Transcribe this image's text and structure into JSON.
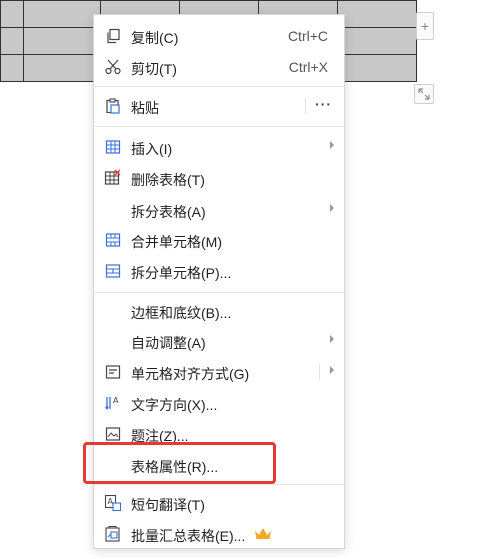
{
  "menu": {
    "items": [
      {
        "label": "复制(C)",
        "shortcut": "Ctrl+C",
        "icon": "copy-icon"
      },
      {
        "label": "剪切(T)",
        "shortcut": "Ctrl+X",
        "icon": "scissors-icon"
      },
      {
        "label": "粘贴",
        "more": "···",
        "icon": "paste-icon"
      },
      {
        "label": "插入(I)",
        "icon": "table-insert-icon",
        "submenu": true
      },
      {
        "label": "删除表格(T)",
        "icon": "table-delete-icon"
      },
      {
        "label": "拆分表格(A)",
        "submenu": true
      },
      {
        "label": "合并单元格(M)",
        "icon": "merge-cells-icon"
      },
      {
        "label": "拆分单元格(P)...",
        "icon": "split-cells-icon"
      },
      {
        "label": "边框和底纹(B)..."
      },
      {
        "label": "自动调整(A)",
        "submenu": true
      },
      {
        "label": "单元格对齐方式(G)",
        "icon": "cell-align-icon",
        "submenu": true
      },
      {
        "label": "文字方向(X)...",
        "icon": "text-direction-icon"
      },
      {
        "label": "题注(Z)...",
        "icon": "caption-icon"
      },
      {
        "label": "表格属性(R)..."
      },
      {
        "label": "短句翻译(T)",
        "icon": "translate-icon"
      },
      {
        "label": "批量汇总表格(E)...",
        "icon": "batch-summary-icon",
        "badge": "crown-icon"
      }
    ]
  },
  "side": {
    "add_label": "+"
  },
  "colors": {
    "highlight": "#e53935",
    "crown": "#f5a623",
    "icon_blue": "#3a6fd8"
  }
}
